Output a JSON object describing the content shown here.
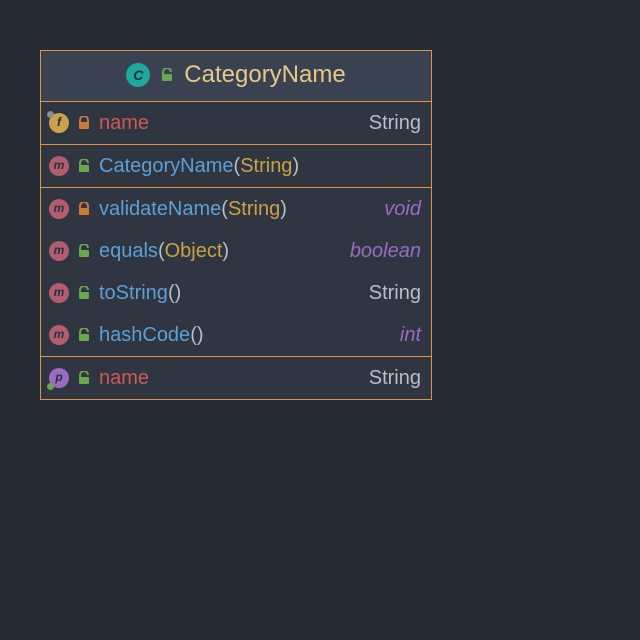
{
  "class": {
    "title": "CategoryName",
    "icon": "c",
    "visibility": "public"
  },
  "sections": [
    {
      "rows": [
        {
          "kind": "f",
          "decor": "tl-grey",
          "visibility": "private",
          "name": "name",
          "nameColor": "red",
          "params": null,
          "ret": "String",
          "retItalic": false
        }
      ]
    },
    {
      "rows": [
        {
          "kind": "m",
          "decor": null,
          "visibility": "public",
          "name": "CategoryName",
          "nameColor": "blue",
          "params": "String",
          "ret": "",
          "retItalic": false
        }
      ]
    },
    {
      "rows": [
        {
          "kind": "m",
          "decor": null,
          "visibility": "private",
          "name": "validateName",
          "nameColor": "blue",
          "params": "String",
          "ret": "void",
          "retItalic": true
        },
        {
          "kind": "m",
          "decor": null,
          "visibility": "public",
          "name": "equals",
          "nameColor": "blue",
          "params": "Object",
          "ret": "boolean",
          "retItalic": true
        },
        {
          "kind": "m",
          "decor": null,
          "visibility": "public",
          "name": "toString",
          "nameColor": "blue",
          "params": "",
          "ret": "String",
          "retItalic": false
        },
        {
          "kind": "m",
          "decor": null,
          "visibility": "public",
          "name": "hashCode",
          "nameColor": "blue",
          "params": "",
          "ret": "int",
          "retItalic": true
        }
      ]
    },
    {
      "rows": [
        {
          "kind": "p",
          "decor": "bl-green",
          "visibility": "public",
          "name": "name",
          "nameColor": "red",
          "params": null,
          "ret": "String",
          "retItalic": false
        }
      ]
    }
  ],
  "colors": {
    "border": "#e09443",
    "bg": "#252a34",
    "panel": "#2f3541",
    "header": "#3a4150"
  }
}
